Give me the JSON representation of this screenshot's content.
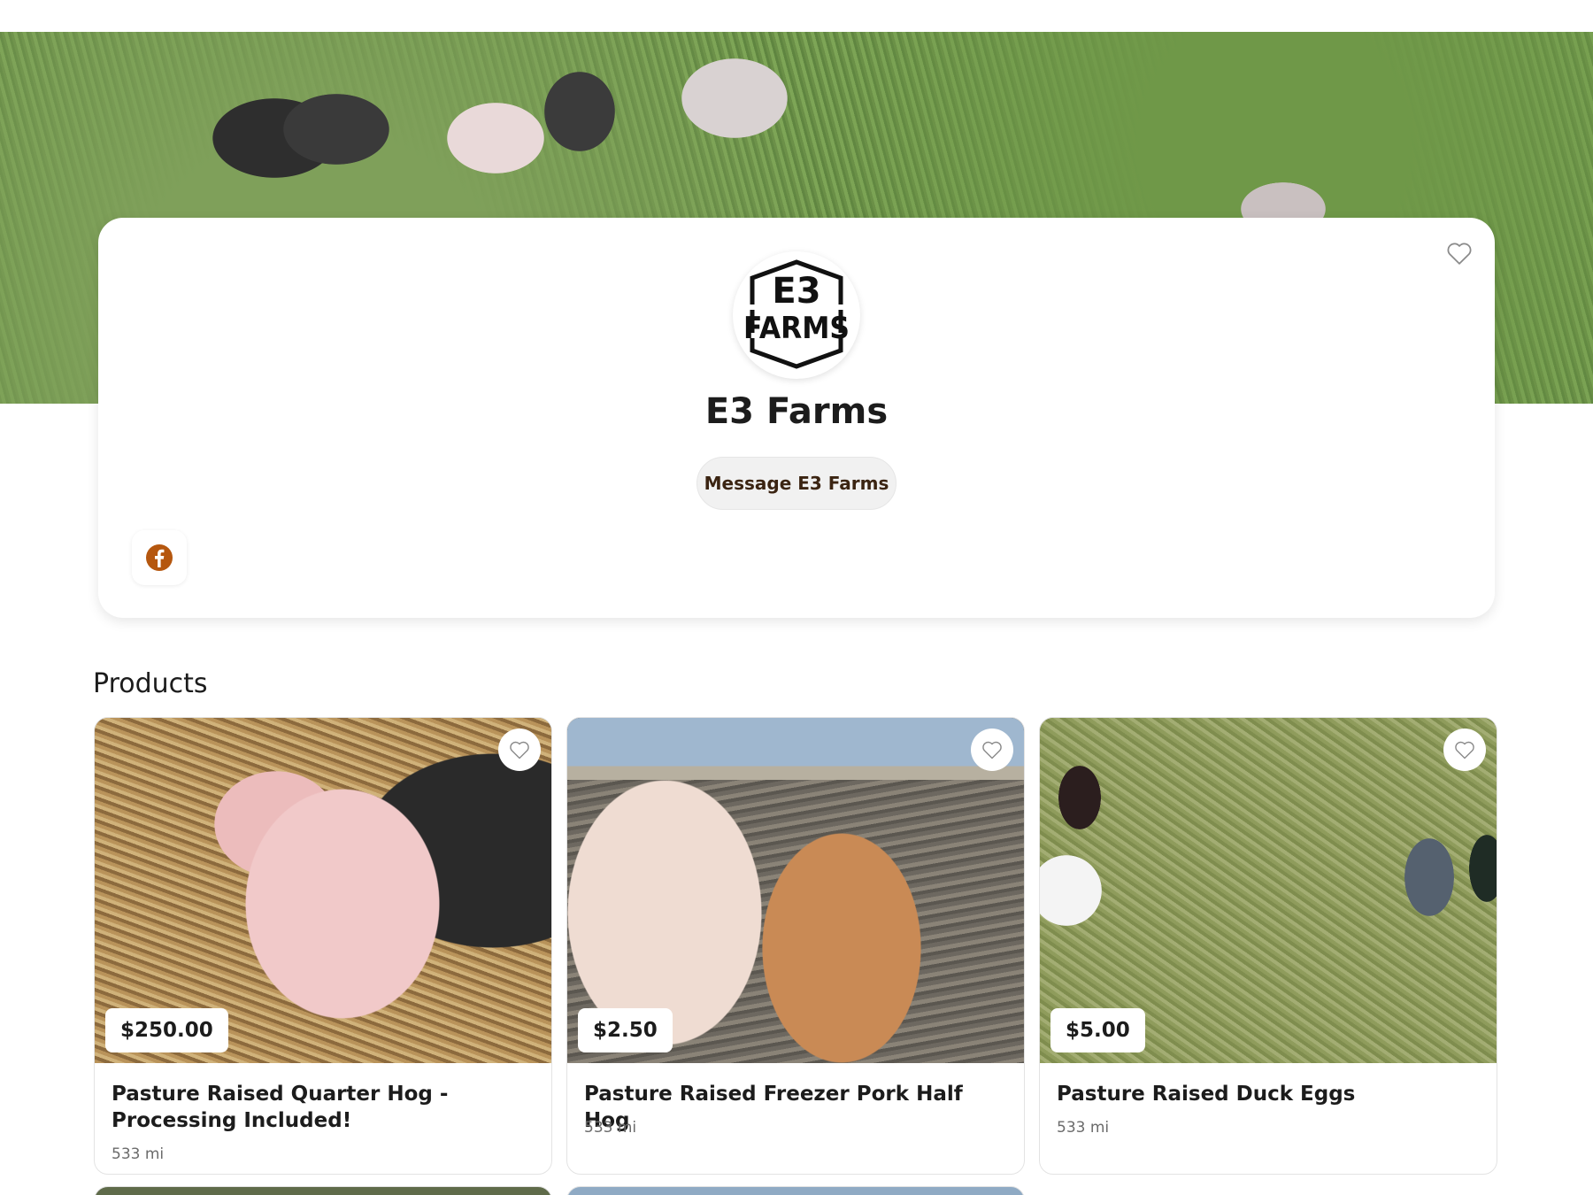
{
  "farm": {
    "name": "E3 Farms",
    "message_label": "Message E3 Farms",
    "logo_text_top": "E3",
    "logo_text_bottom": "FARMS"
  },
  "products_heading": "Products",
  "products": [
    {
      "price": "$250.00",
      "title": "Pasture Raised Quarter Hog - Processing Included!",
      "distance": "533 mi"
    },
    {
      "price": "$2.50",
      "title": "Pasture Raised Freezer Pork Half Hog",
      "distance": "533 mi"
    },
    {
      "price": "$5.00",
      "title": "Pasture Raised Duck Eggs",
      "distance": "533 mi"
    }
  ],
  "icons": {
    "favorite": "heart-outline-icon",
    "social": "facebook-icon"
  },
  "colors": {
    "facebook": "#b5570f",
    "message_text": "#3b2412"
  }
}
